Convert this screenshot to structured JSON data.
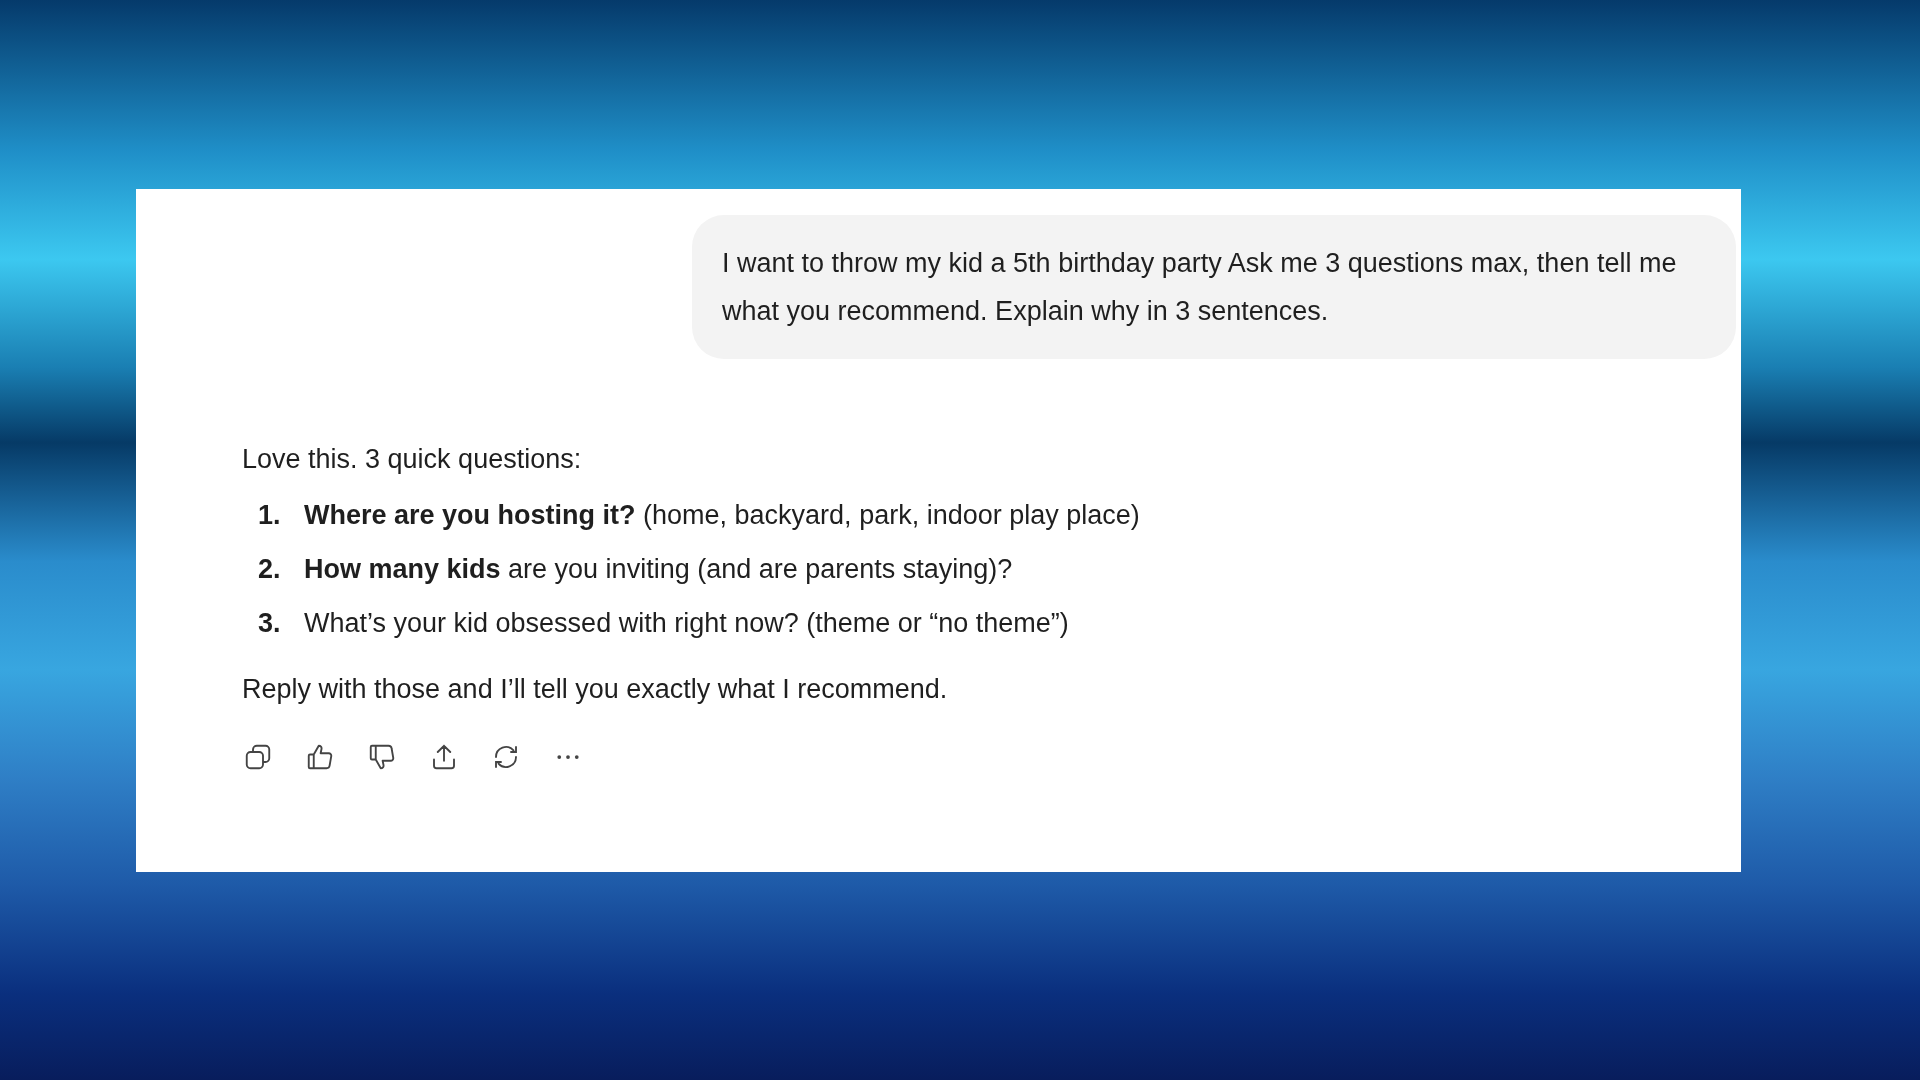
{
  "user_message": {
    "text": "I want to throw my kid a 5th birthday party Ask me 3 questions max, then tell me what you recommend. Explain why in 3 sentences."
  },
  "assistant_message": {
    "intro": "Love this. 3 quick questions:",
    "questions": [
      {
        "number": "1.",
        "text": "**Where are you hosting it?** (home, backyard, park, indoor play place)"
      },
      {
        "number": "2.",
        "text": "**How many kids** are you inviting (and are parents staying)?"
      },
      {
        "number": "3.",
        "text": "What’s your kid obsessed with right now? (theme or “no theme”)"
      }
    ],
    "outro": "Reply with those and I’ll tell you exactly what I recommend."
  }
}
